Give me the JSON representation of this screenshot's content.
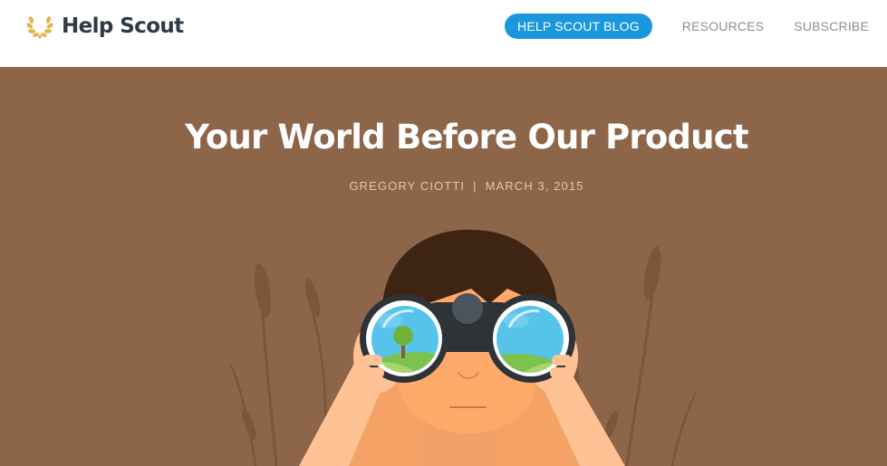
{
  "header": {
    "logo_text": "Help Scout",
    "logo_icon": "laurel-wreath-icon",
    "nav": [
      {
        "label": "HELP SCOUT BLOG",
        "active": true
      },
      {
        "label": "RESOURCES",
        "active": false
      },
      {
        "label": "SUBSCRIBE",
        "active": false
      }
    ]
  },
  "post": {
    "title": "Your World Before Our Product",
    "author": "GREGORY CIOTTI",
    "separator": "|",
    "date": "MARCH 3, 2015",
    "illustration": "person-with-binoculars-illustration"
  },
  "colors": {
    "hero_background": "#8d6548",
    "nav_active": "#1a97dd",
    "logo_text": "#2f3a45",
    "logo_gold": "#e2b649"
  }
}
